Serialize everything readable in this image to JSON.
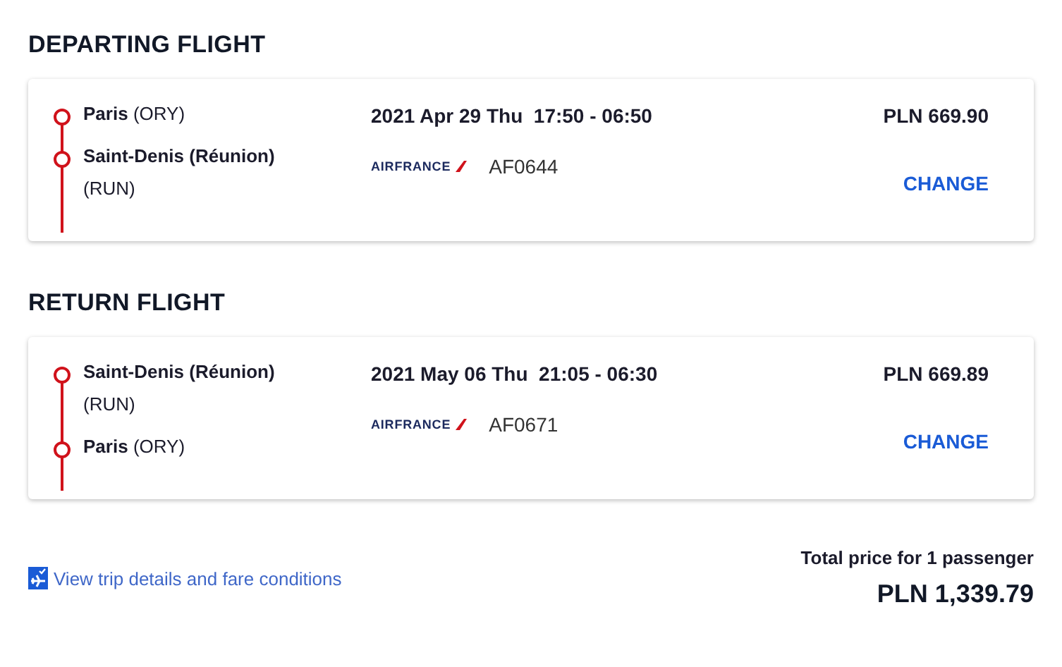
{
  "sections": [
    {
      "heading": "DEPARTING FLIGHT",
      "stops": [
        {
          "name": "Paris",
          "code": "(ORY)"
        },
        {
          "name": "Saint-Denis (Réunion)",
          "code": "(RUN)"
        }
      ],
      "date_time": "2021 Apr 29 Thu  17:50 - 06:50",
      "airline_logo": "AIRFRANCE",
      "flight_number": "AF0644",
      "price": "PLN 669.90",
      "action": "CHANGE"
    },
    {
      "heading": "RETURN FLIGHT",
      "stops": [
        {
          "name": "Saint-Denis (Réunion)",
          "code": "(RUN)"
        },
        {
          "name": "Paris",
          "code": "(ORY)"
        }
      ],
      "date_time": "2021 May 06 Thu  21:05 - 06:30",
      "airline_logo": "AIRFRANCE",
      "flight_number": "AF0671",
      "price": "PLN 669.89",
      "action": "CHANGE"
    }
  ],
  "details_link": "View trip details and fare conditions",
  "total": {
    "label": "Total price for 1 passenger",
    "amount": "PLN 1,339.79"
  }
}
